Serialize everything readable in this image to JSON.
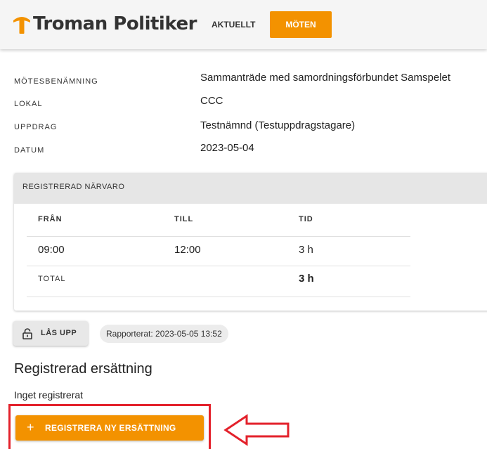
{
  "header": {
    "brand_name": "Troman Politiker",
    "brand_color": "#f39200",
    "nav": [
      {
        "label": "AKTUELLT",
        "active": false
      },
      {
        "label": "MÖTEN",
        "active": true
      }
    ]
  },
  "meeting": {
    "fields": [
      {
        "label": "MÖTESBENÄMNING",
        "value": "Sammanträde med samordningsförbundet Samspelet"
      },
      {
        "label": "LOKAL",
        "value": "CCC"
      },
      {
        "label": "UPPDRAG",
        "value": "Testnämnd (Testuppdragstagare)"
      },
      {
        "label": "DATUM",
        "value": "2023-05-04"
      }
    ]
  },
  "attendance": {
    "title": "REGISTRERAD NÄRVARO",
    "columns": [
      "FRÅN",
      "TILL",
      "TID"
    ],
    "rows": [
      {
        "from": "09:00",
        "to": "12:00",
        "time": "3 h"
      }
    ],
    "total_label": "TOTAL",
    "total_time": "3 h"
  },
  "actions": {
    "unlock_label": "LÅS UPP",
    "unlock_icon": "lock-open-icon",
    "reported_text": "Rapporterat: 2023-05-05 13:52"
  },
  "compensation": {
    "title": "Registrerad ersättning",
    "empty_text": "Inget registrerat",
    "register_button_label": "REGISTRERA NY ERSÄTTNING",
    "register_icon": "plus-icon"
  },
  "annotation": {
    "highlight_color": "#e3212b",
    "arrow_icon": "arrow-left-outline-icon"
  }
}
